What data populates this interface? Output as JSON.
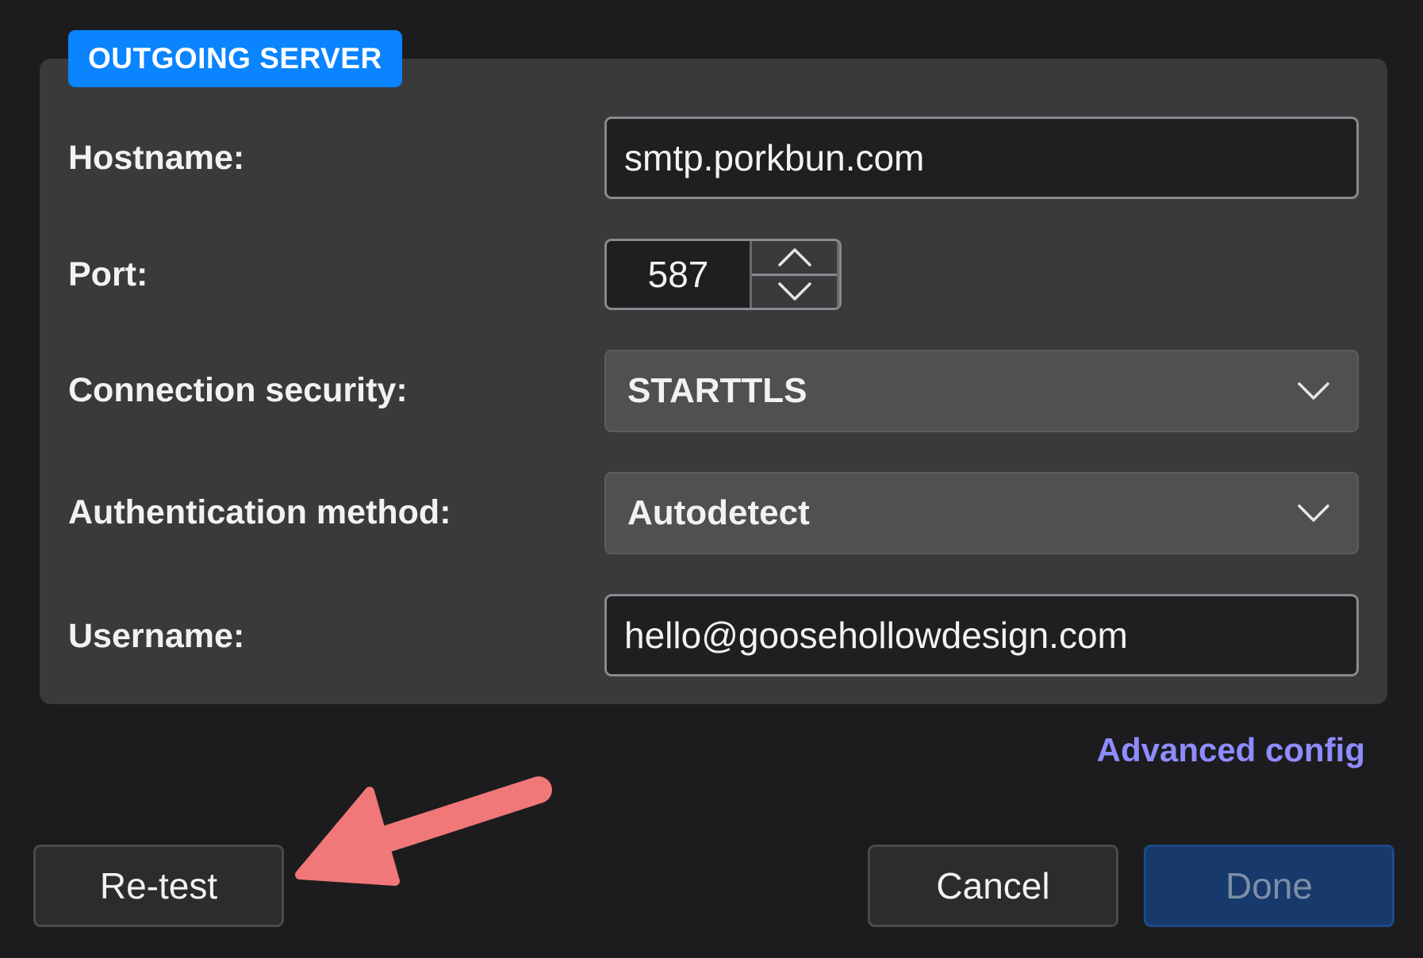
{
  "section": {
    "title": "OUTGOING SERVER"
  },
  "form": {
    "hostname": {
      "label": "Hostname:",
      "value": "smtp.porkbun.com"
    },
    "port": {
      "label": "Port:",
      "value": "587"
    },
    "connection_security": {
      "label": "Connection security:",
      "selected": "STARTTLS"
    },
    "authentication_method": {
      "label": "Authentication method:",
      "selected": "Autodetect"
    },
    "username": {
      "label": "Username:",
      "value": "hello@goosehollowdesign.com"
    }
  },
  "links": {
    "advanced_config": "Advanced config"
  },
  "buttons": {
    "retest": "Re-test",
    "cancel": "Cancel",
    "done": "Done"
  },
  "colors": {
    "background": "#1c1c1e",
    "panel": "#3a3a3c",
    "accent": "#0a84ff",
    "link": "#8e8cff",
    "done_button": "#17396b",
    "annotation": "#f07878"
  },
  "icons": {
    "stepper_up": "chevron-up-icon",
    "stepper_down": "chevron-down-icon",
    "select_chevron": "chevron-down-icon",
    "annotation": "arrow-annotation-icon"
  }
}
